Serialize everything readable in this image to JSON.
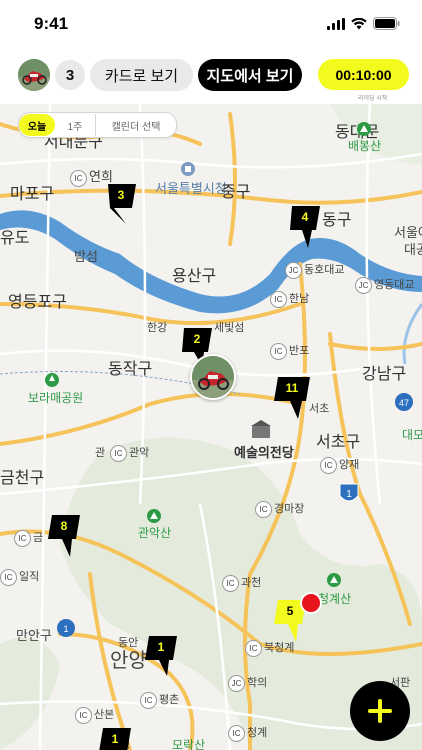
{
  "status_bar": {
    "time": "9:41"
  },
  "header": {
    "count": "3",
    "card_view_label": "카드로 보기",
    "map_view_label": "지도에서 보기",
    "timer": "00:10:00",
    "timer_caption": "라이딩 시작"
  },
  "filter": {
    "today": "오늘",
    "week": "1주",
    "calendar": "캘린더 선택"
  },
  "markers": [
    {
      "label": "3",
      "color": "#000000"
    },
    {
      "label": "4",
      "color": "#000000"
    },
    {
      "label": "2",
      "color": "#000000"
    },
    {
      "label": "11",
      "color": "#000000"
    },
    {
      "label": "8",
      "color": "#000000"
    },
    {
      "label": "5",
      "color": "#f3fa1e"
    },
    {
      "label": "1",
      "color": "#000000"
    },
    {
      "label": "1",
      "color": "#000000"
    }
  ],
  "map_labels": {
    "seodaemun": "서대문구",
    "dongdaemun": "동대문",
    "baebongsan": "배봉산",
    "mapo": "마포구",
    "yeonhui": "연희",
    "cityhall": "서울특별시청",
    "junggu": "중구",
    "yudo": "유도",
    "bamseom": "밤섬",
    "yongsan": "용산구",
    "seongdong": "동구",
    "seoulsup": "서울어",
    "daegong": "대공",
    "yeongdeungpo": "영등포구",
    "okdong": "옥수",
    "dongho": "동호대교",
    "yeongdong": "영동대교",
    "hannam": "한남",
    "hangang": "한강",
    "sebitseom": "세빛섬",
    "dongjak": "동작구",
    "banpo": "반포",
    "gangnam": "강남구",
    "boramae": "보라매공원",
    "seocho": "서초",
    "seochogu": "서초구",
    "yesul": "예술의전당",
    "gwanak": "관악",
    "gwan": "관",
    "yangjae": "양재",
    "daemo": "대모",
    "geumcheon": "금천구",
    "route1": "1",
    "gyeongmajang": "경마장",
    "gwanaksan": "관악산",
    "gwacheon": "과천",
    "cheonggyesan": "청계산",
    "ilmjik": "일직",
    "manan": "만안구",
    "anyang": "안양",
    "dongan": "동안",
    "bukcheonggye": "북청계",
    "pyeongchon": "평촌",
    "hakui": "학의",
    "sanbon": "산본",
    "geumjeong": "금정",
    "cheonggye": "청계",
    "moraksan": "모락산",
    "seopan": "서판",
    "geum": "금"
  },
  "colors": {
    "accent": "#f3fa1e",
    "river": "#5b9bd5",
    "road": "#f6c35a"
  }
}
